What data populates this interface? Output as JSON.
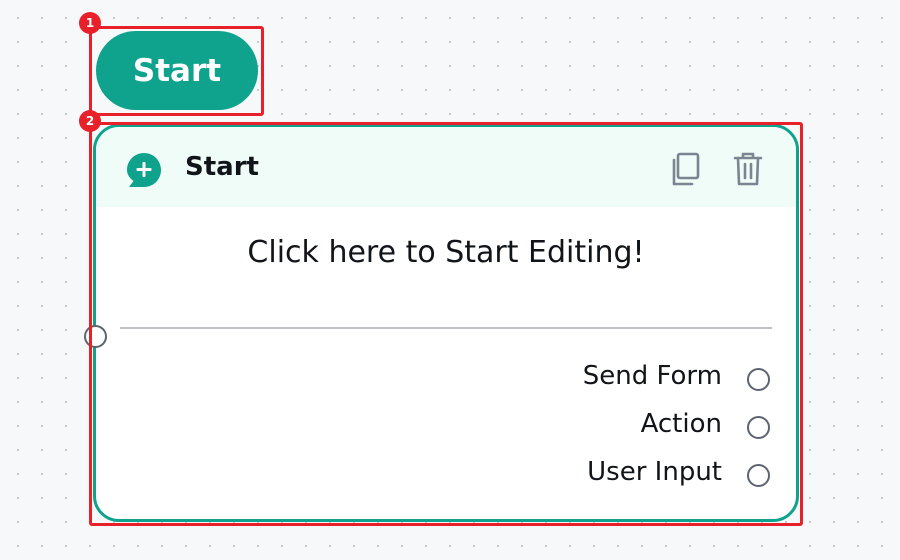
{
  "start_pill": {
    "label": "Start"
  },
  "node": {
    "title": "Start",
    "body_text": "Click here to Start Editing!",
    "options": [
      {
        "label": "Send Form"
      },
      {
        "label": "Action"
      },
      {
        "label": "User Input"
      }
    ]
  },
  "annotations": [
    {
      "number": "1"
    },
    {
      "number": "2"
    }
  ],
  "icons": {
    "node_icon": "chat-plus-icon",
    "copy": "copy-icon",
    "delete": "trash-icon"
  },
  "colors": {
    "accent": "#0fa38d",
    "header_bg": "#effcf7",
    "annotation": "#e8202a",
    "handle_border": "#5b6470"
  }
}
